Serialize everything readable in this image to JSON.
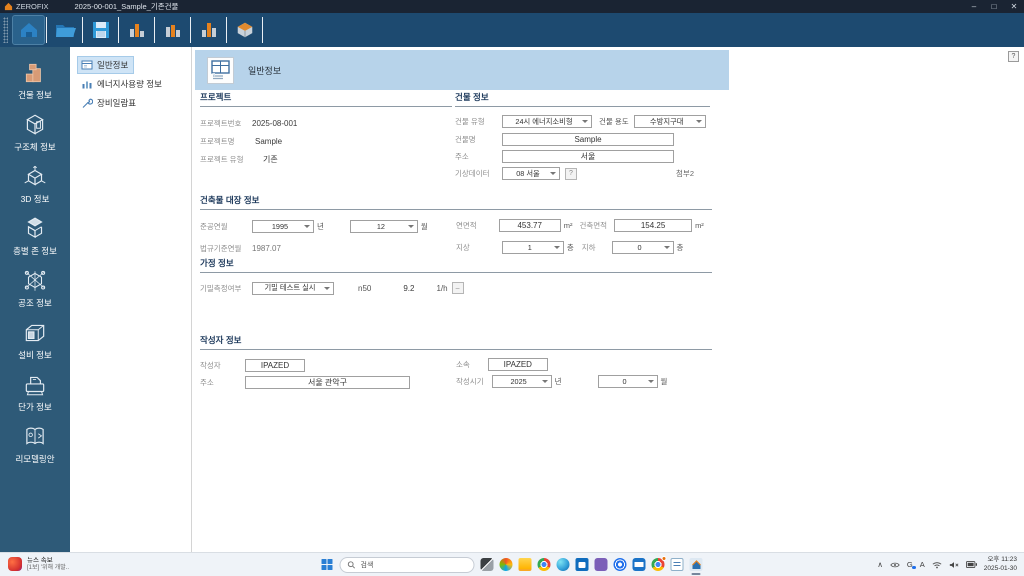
{
  "titlebar": {
    "app": "ZEROFIX",
    "doc": "2025-00-001_Sample_기존건물",
    "min": "–",
    "max": "□",
    "close": "✕"
  },
  "sidebar": {
    "items": [
      {
        "label": "건물 정보"
      },
      {
        "label": "구조체 정보"
      },
      {
        "label": "3D 정보"
      },
      {
        "label": "층별 존 정보"
      },
      {
        "label": "공조 정보"
      },
      {
        "label": "설비 정보"
      },
      {
        "label": "단가 정보"
      },
      {
        "label": "리모델링안"
      }
    ]
  },
  "nav": {
    "items": [
      {
        "label": "일반정보"
      },
      {
        "label": "에너지사용량 정보"
      },
      {
        "label": "장비일람표"
      }
    ]
  },
  "header": {
    "title": "일반정보",
    "help": "?"
  },
  "sections": {
    "project": {
      "title": "프로젝트",
      "no_label": "프로젝트번호",
      "no": "2025-08-001",
      "name_label": "프로젝트명",
      "name": "Sample",
      "type_label": "프로젝트 유형",
      "type": "기존"
    },
    "building": {
      "title": "건물 정보",
      "type_label": "건물 유형",
      "type_value": "24시 에너지소비형",
      "use_label": "건물 용도",
      "use_value": "수방지구대",
      "name_label": "건물명",
      "name_value": "Sample",
      "addr_label": "주소",
      "addr_value": "서울",
      "weather_label": "기상데이터",
      "weather_value": "08 서울",
      "weather_help": "?",
      "attach": "첨부2"
    },
    "ledger": {
      "title": "건축물 대장 정보",
      "completion_label": "준공연월",
      "year": "1995",
      "year_unit": "년",
      "month": "12",
      "month_unit": "월",
      "area_label": "연면적",
      "area": "453.77",
      "area_unit": "m²",
      "barea_label": "건축면적",
      "barea": "154.25",
      "barea_unit": "m²",
      "law_label": "법규기준연월",
      "law": "1987.07",
      "above_label": "지상",
      "above": "1",
      "above_unit": "층",
      "below_label": "지하",
      "below": "0",
      "below_unit": "층"
    },
    "assume": {
      "title": "가정 정보",
      "airtight_label": "기밀측정여부",
      "airtight_value": "기밀 테스트 실시",
      "n50_label": "n50",
      "n50_value": "9.2",
      "n50_unit": "1/h",
      "n50_btn": "–"
    },
    "author": {
      "title": "작성자 정보",
      "writer_label": "작성자",
      "writer": "IPAZED",
      "org_label": "소속",
      "org": "IPAZED",
      "addr_label": "주소",
      "addr": "서울 관악구",
      "date_label": "작성시기",
      "year": "2025",
      "year_unit": "년",
      "month": "0",
      "month_unit": "월"
    }
  },
  "taskbar": {
    "news_title": "뉴스 속보",
    "news_sub": "[1보] '위해 개발..",
    "search_placeholder": "검색",
    "ime": "A",
    "g": "G",
    "time": "오후 11:23",
    "date": "2025-01-30"
  },
  "colors": {
    "accent_blue": "#2e5a78",
    "banner_blue": "#b7d3ea",
    "toolbar_blue": "#1d4a70",
    "orange": "#e5821e"
  }
}
